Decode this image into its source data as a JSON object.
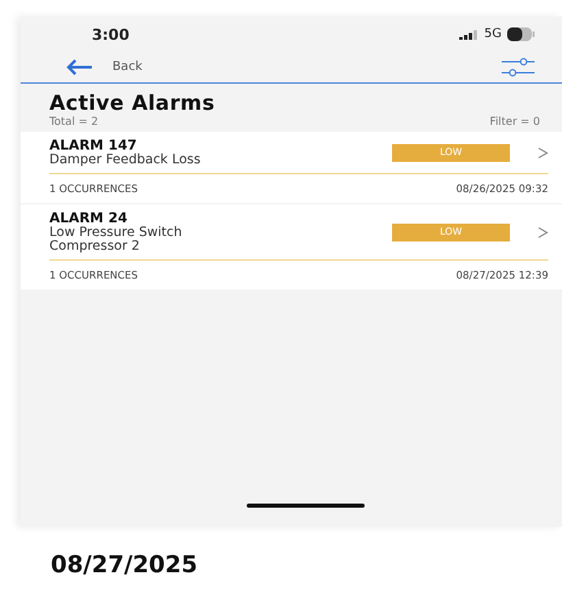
{
  "status_bar": {
    "time": "3:00",
    "network": "5G"
  },
  "nav": {
    "back_label": "Back"
  },
  "header": {
    "title": "Active Alarms",
    "total": "Total = 2",
    "filter": "Filter = 0"
  },
  "alarms": [
    {
      "title": "ALARM 147",
      "description": "Damper Feedback Loss",
      "severity": "LOW",
      "occurrences": "1 OCCURRENCES",
      "timestamp": "08/26/2025 09:32"
    },
    {
      "title": "ALARM 24",
      "description": "Low Pressure Switch Compressor 2",
      "severity": "LOW",
      "occurrences": "1 OCCURRENCES",
      "timestamp": "08/27/2025 12:39"
    }
  ],
  "caption": "08/27/2025"
}
